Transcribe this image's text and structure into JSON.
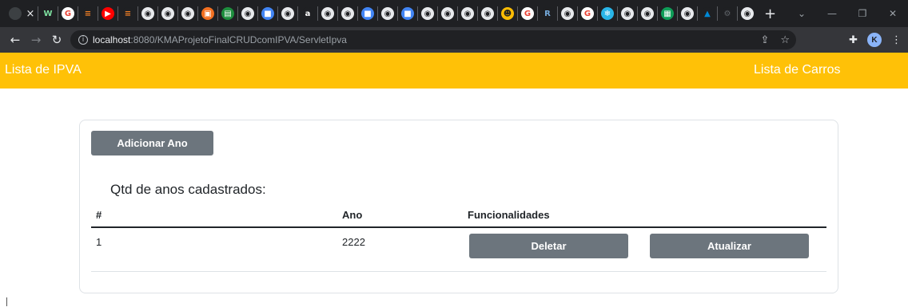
{
  "browser": {
    "url_host": "localhost",
    "url_path": ":8080/KMAProjetoFinalCRUDcomIPVA/ServletIpva",
    "profile_initial": "K",
    "tab_close_glyph": "×",
    "new_tab_glyph": "+",
    "tab_favicons": [
      {
        "name": "wix-favicon",
        "glyph": "W",
        "color": "#1f2023",
        "fg": "#7ee0a0"
      },
      {
        "name": "google-favicon",
        "glyph": "G",
        "color": "#ffffff",
        "fg": "#ea4335"
      },
      {
        "name": "stack-favicon",
        "glyph": "≡",
        "color": "#1f2023",
        "fg": "#f48024"
      },
      {
        "name": "youtube-favicon",
        "glyph": "▶",
        "color": "#ff0000",
        "fg": "#ffffff"
      },
      {
        "name": "stack-favicon",
        "glyph": "≡",
        "color": "#1f2023",
        "fg": "#f48024"
      },
      {
        "name": "github-favicon",
        "glyph": "◉",
        "color": "#e8eaed",
        "fg": "#1f2023"
      },
      {
        "name": "github-favicon",
        "glyph": "◉",
        "color": "#e8eaed",
        "fg": "#1f2023"
      },
      {
        "name": "github-favicon",
        "glyph": "◉",
        "color": "#e8eaed",
        "fg": "#1f2023"
      },
      {
        "name": "orange-favicon",
        "glyph": "▣",
        "color": "#f37021",
        "fg": "#ffffff"
      },
      {
        "name": "classroom-favicon",
        "glyph": "▤",
        "color": "#1e8e3e",
        "fg": "#ffffff"
      },
      {
        "name": "github-favicon",
        "glyph": "◉",
        "color": "#e8eaed",
        "fg": "#1f2023"
      },
      {
        "name": "meet-favicon",
        "glyph": "■",
        "color": "#4285f4",
        "fg": "#ffffff"
      },
      {
        "name": "github-favicon",
        "glyph": "◉",
        "color": "#e8eaed",
        "fg": "#1f2023"
      },
      {
        "name": "amazon-favicon",
        "glyph": "a",
        "color": "#1f2023",
        "fg": "#ffffff"
      },
      {
        "name": "github-favicon",
        "glyph": "◉",
        "color": "#e8eaed",
        "fg": "#1f2023"
      },
      {
        "name": "github-favicon",
        "glyph": "◉",
        "color": "#e8eaed",
        "fg": "#1f2023"
      },
      {
        "name": "meet-favicon",
        "glyph": "■",
        "color": "#4285f4",
        "fg": "#ffffff"
      },
      {
        "name": "github-favicon",
        "glyph": "◉",
        "color": "#e8eaed",
        "fg": "#1f2023"
      },
      {
        "name": "meet-favicon",
        "glyph": "■",
        "color": "#4285f4",
        "fg": "#ffffff"
      },
      {
        "name": "github-favicon",
        "glyph": "◉",
        "color": "#e8eaed",
        "fg": "#1f2023"
      },
      {
        "name": "github-favicon",
        "glyph": "◉",
        "color": "#e8eaed",
        "fg": "#1f2023"
      },
      {
        "name": "github-favicon",
        "glyph": "◉",
        "color": "#e8eaed",
        "fg": "#1f2023"
      },
      {
        "name": "github-favicon",
        "glyph": "◉",
        "color": "#e8eaed",
        "fg": "#1f2023"
      },
      {
        "name": "smiley-favicon",
        "glyph": "☻",
        "color": "#fbbc04",
        "fg": "#1f2023"
      },
      {
        "name": "google-favicon",
        "glyph": "G",
        "color": "#ffffff",
        "fg": "#ea4335"
      },
      {
        "name": "rstudio-favicon",
        "glyph": "R",
        "color": "#1f2023",
        "fg": "#75aadb"
      },
      {
        "name": "github-favicon",
        "glyph": "◉",
        "color": "#e8eaed",
        "fg": "#1f2023"
      },
      {
        "name": "google-favicon",
        "glyph": "G",
        "color": "#ffffff",
        "fg": "#ea4335"
      },
      {
        "name": "snowflake-favicon",
        "glyph": "❄",
        "color": "#29b5e8",
        "fg": "#ffffff"
      },
      {
        "name": "github-favicon",
        "glyph": "◉",
        "color": "#e8eaed",
        "fg": "#1f2023"
      },
      {
        "name": "github-favicon",
        "glyph": "◉",
        "color": "#e8eaed",
        "fg": "#1f2023"
      },
      {
        "name": "sheets-favicon",
        "glyph": "▦",
        "color": "#0f9d58",
        "fg": "#ffffff"
      },
      {
        "name": "github-favicon",
        "glyph": "◉",
        "color": "#e8eaed",
        "fg": "#1f2023"
      },
      {
        "name": "azure-favicon",
        "glyph": "▲",
        "color": "#1f2023",
        "fg": "#0089d6"
      },
      {
        "name": "chrome-favicon",
        "glyph": "⚙",
        "color": "#1f2023",
        "fg": "#5f6368"
      },
      {
        "name": "github-favicon",
        "glyph": "◉",
        "color": "#e8eaed",
        "fg": "#1f2023"
      }
    ]
  },
  "navbar": {
    "brand": "Lista de IPVA",
    "link_carros": "Lista de Carros",
    "background": "#ffc107"
  },
  "card": {
    "add_button_label": "Adicionar Ano",
    "count_label": "Qtd de anos cadastrados:"
  },
  "table": {
    "headers": {
      "num": "#",
      "ano": "Ano",
      "func": "Funcionalidades"
    },
    "rows": [
      {
        "num": "1",
        "ano": "2222",
        "delete_label": "Deletar",
        "update_label": "Atualizar"
      }
    ]
  },
  "colors": {
    "button_gray": "#6c757d",
    "text": "#212529"
  }
}
